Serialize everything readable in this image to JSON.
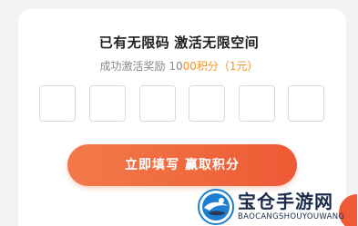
{
  "dialog": {
    "title_part1": "已有无限码",
    "title_part2": "激活无限空间",
    "subtitle_prefix": "成功激活奖励 10",
    "subtitle_accent": "00积分（1元）",
    "code_box_count": 6,
    "submit_part1": "立即填写",
    "submit_part2": "赢取积分"
  },
  "watermark": {
    "name": "宝仓手游网",
    "url": "BAOCANGSHOUYOUWANG"
  },
  "colors": {
    "accent": "#f0932e",
    "button": "#ee5a35",
    "watermark": "#1a2a4a"
  }
}
